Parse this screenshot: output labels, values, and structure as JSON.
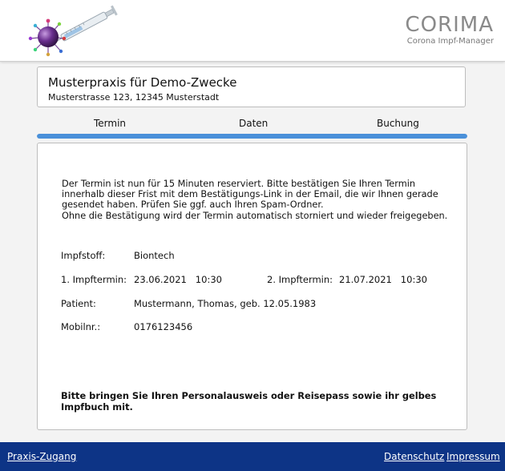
{
  "header": {
    "brand_title": "CORIMA",
    "brand_subtitle": "Corona Impf-Manager"
  },
  "practice": {
    "name": "Musterpraxis für Demo-Zwecke",
    "address": "Musterstrasse 123, 12345 Musterstadt"
  },
  "steps": {
    "items": [
      "Termin",
      "Daten",
      "Buchung"
    ],
    "progress_fraction": 1.0,
    "accent_color": "#4a90d9"
  },
  "notice": {
    "line1": "Der Termin ist nun für 15 Minuten reserviert. Bitte bestätigen Sie Ihren Termin",
    "line2": "innerhalb dieser Frist mit dem Bestätigungs-Link in der Email, die wir Ihnen gerade",
    "line3": "gesendet haben. Prüfen Sie ggf. auch Ihren Spam-Ordner.",
    "line4": "Ohne die Bestätigung wird der Termin automatisch storniert und wieder freigegeben."
  },
  "details": {
    "impfstoff_label": "Impfstoff:",
    "impfstoff_value": "Biontech",
    "termin1_label": "1. Impftermin:",
    "termin1_value": "23.06.2021   10:30",
    "termin2_label": "2. Impftermin:",
    "termin2_value": "21.07.2021   10:30",
    "patient_label": "Patient:",
    "patient_value": "Mustermann, Thomas, geb. 12.05.1983",
    "mobil_label": "Mobilnr.:",
    "mobil_value": "0176123456"
  },
  "reminder": {
    "line1": "Bitte bringen Sie Ihren Personalausweis oder Reisepass sowie ihr gelbes",
    "line2": "Impfbuch mit."
  },
  "footer": {
    "praxis_link": "Praxis-Zugang",
    "datenschutz_link": "Datenschutz",
    "impressum_link": "Impressum",
    "background_color": "#0d3486"
  }
}
